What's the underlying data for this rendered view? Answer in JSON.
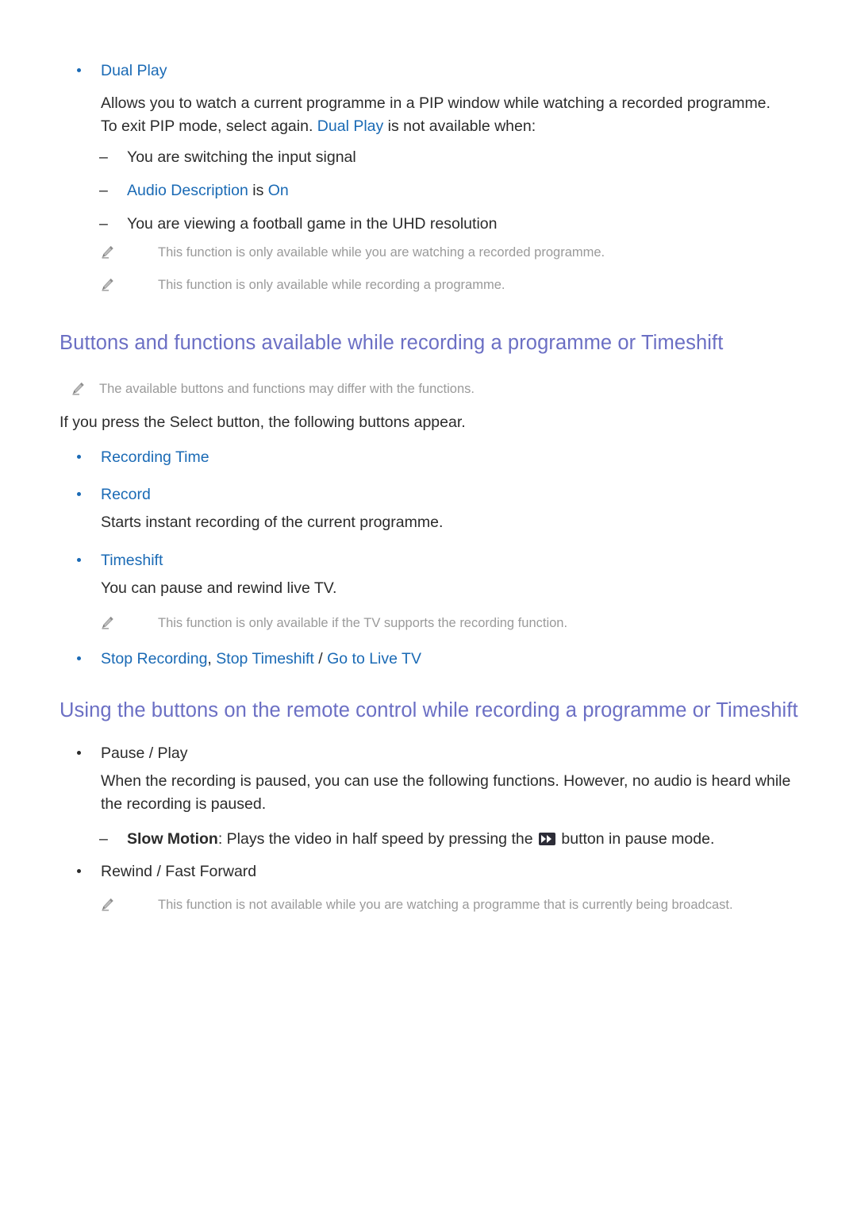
{
  "colors": {
    "link_blue": "#1a6ab5",
    "heading_purple": "#6b6fc4",
    "body_black": "#2b2b2b",
    "note_gray": "#9a9a9a"
  },
  "sections": {
    "dual_play": {
      "bullet_label": "Dual Play",
      "description_line1": "Allows you to watch a current programme in a PIP window while watching a recorded programme.",
      "description_line2_pre": "To exit PIP mode, select again. ",
      "description_line2_link": "Dual Play",
      "description_line2_post": " is not available when:",
      "conditions": [
        {
          "text": "You are switching the input signal"
        }
      ],
      "audio_description_pre": "Audio Description",
      "audio_description_mid": " is ",
      "audio_description_post": "On",
      "condition_uhd": "You are viewing a football game in the UHD resolution",
      "notes": [
        "This function is only available while you are watching a recorded programme.",
        "This function is only available while recording a programme."
      ]
    },
    "buttons_functions": {
      "heading": "Buttons and functions available while recording a programme or Timeshift",
      "note": "The available buttons and functions may differ with the functions.",
      "intro": "If you press the Select button, the following buttons appear.",
      "items": [
        {
          "label": "Recording Time",
          "description": null
        },
        {
          "label": "Record",
          "description": "Starts instant recording of the current programme."
        },
        {
          "label": "Timeshift",
          "description": "You can pause and rewind live TV."
        }
      ],
      "timeshift_note": "This function is only available if the TV supports the recording function.",
      "stop_item": {
        "part1": "Stop Recording",
        "sep1": ", ",
        "part2": "Stop Timeshift",
        "sep2": " / ",
        "part3": "Go to Live TV"
      }
    },
    "remote_buttons": {
      "heading": "Using the buttons on the remote control while recording a programme or Timeshift",
      "pause_play_label": "Pause / Play",
      "pause_play_description": "When the recording is paused, you can use the following functions. However, no audio is heard while the recording is paused.",
      "slow_motion_label": "Slow Motion",
      "slow_motion_pre": ": Plays the video in half speed by pressing the ",
      "slow_motion_post": " button in pause mode.",
      "rewind_label": "Rewind / Fast Forward",
      "rewind_note": "This function is not available while you are watching a programme that is currently being broadcast."
    }
  },
  "icons": {
    "pencil": "pencil-icon",
    "fast_forward": "fast-forward-icon"
  }
}
